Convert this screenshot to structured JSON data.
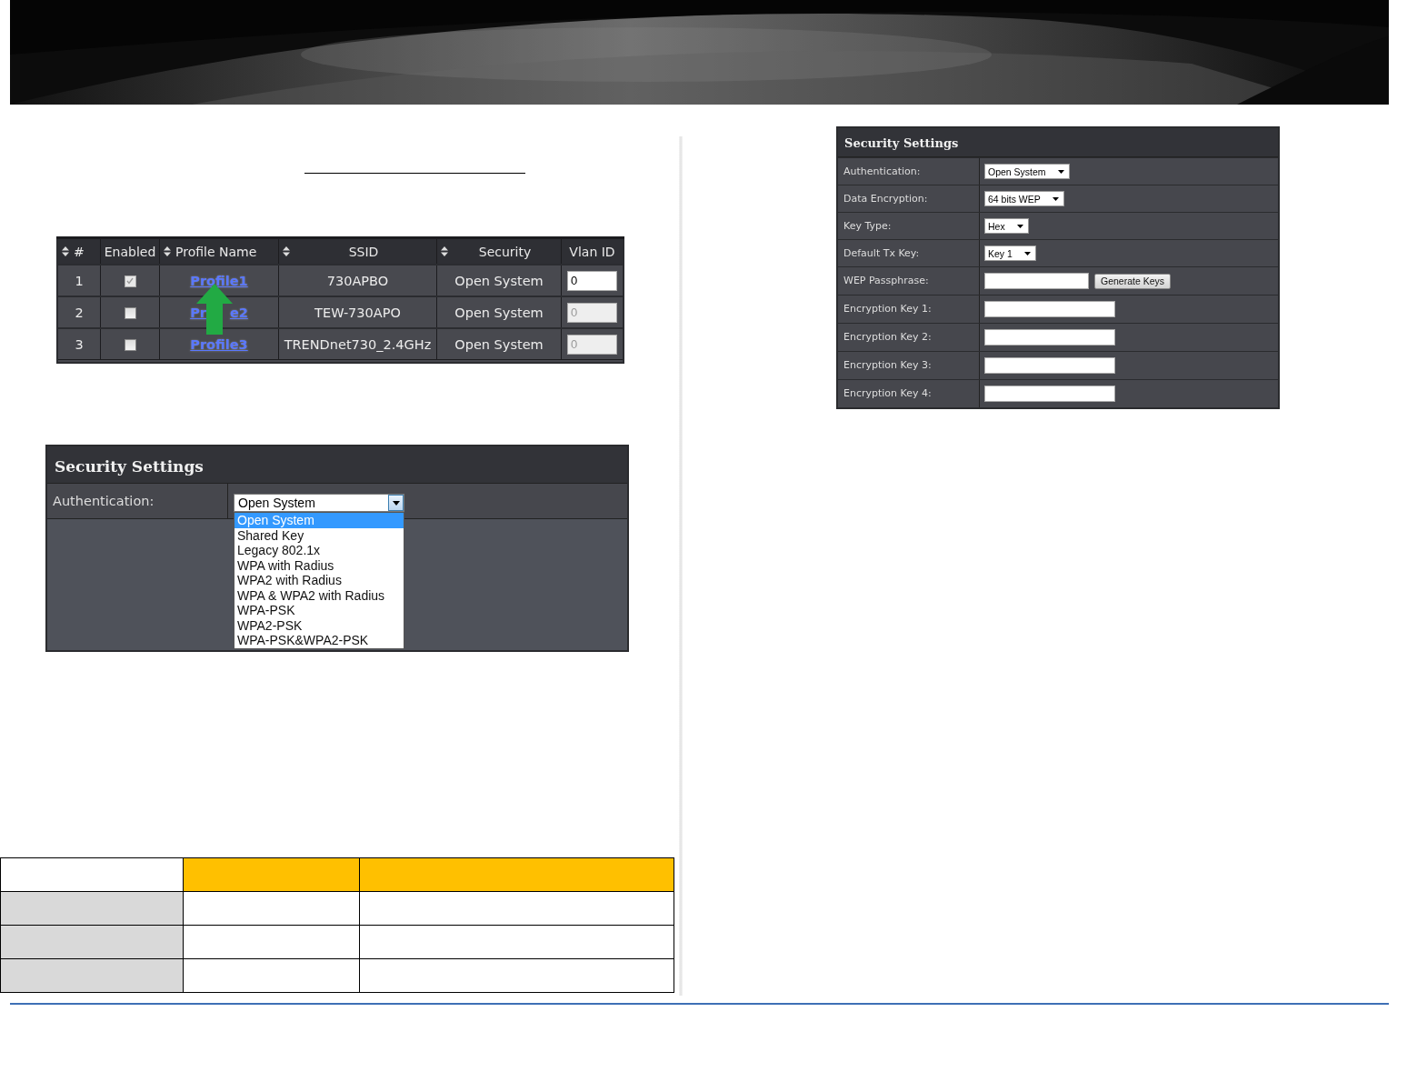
{
  "profiles_table": {
    "columns": [
      {
        "label": "#",
        "sortable": true
      },
      {
        "label": "Enabled",
        "sortable": false
      },
      {
        "label": "Profile Name",
        "sortable": true
      },
      {
        "label": "SSID",
        "sortable": true
      },
      {
        "label": "Security",
        "sortable": true
      },
      {
        "label": "Vlan ID",
        "sortable": false
      }
    ],
    "rows": [
      {
        "number": "1",
        "enabled": true,
        "enabled_disabled": true,
        "profile": "Profile1",
        "ssid": "730APBO",
        "security": "Open System",
        "vlan": "0",
        "vlan_disabled": false
      },
      {
        "number": "2",
        "enabled": false,
        "enabled_disabled": false,
        "profile": "Pr",
        "profile_end": "e2",
        "ssid": "TEW-730APO",
        "security": "Open System",
        "vlan": "0",
        "vlan_disabled": true
      },
      {
        "number": "3",
        "enabled": false,
        "enabled_disabled": false,
        "profile": "Profile3",
        "ssid": "TRENDnet730_2.4GHz",
        "security": "Open System",
        "vlan": "0",
        "vlan_disabled": true
      }
    ]
  },
  "security_dropdown_panel": {
    "title": "Security Settings",
    "label": "Authentication:",
    "value": "Open System",
    "expanded": true,
    "options": [
      {
        "label": "Open System",
        "selected": true
      },
      {
        "label": "Shared Key",
        "selected": false
      },
      {
        "label": "Legacy 802.1x",
        "selected": false
      },
      {
        "label": "WPA with Radius",
        "selected": false
      },
      {
        "label": "WPA2 with Radius",
        "selected": false
      },
      {
        "label": "WPA & WPA2 with Radius",
        "selected": false
      },
      {
        "label": "WPA-PSK",
        "selected": false
      },
      {
        "label": "WPA2-PSK",
        "selected": false
      },
      {
        "label": "WPA-PSK&WPA2-PSK",
        "selected": false
      }
    ]
  },
  "security_settings_panel": {
    "title": "Security Settings",
    "rows": [
      {
        "kind": "select",
        "label": "Authentication:",
        "value": "Open System"
      },
      {
        "kind": "select",
        "label": "Data Encryption:",
        "value": "64 bits WEP"
      },
      {
        "kind": "select",
        "label": "Key Type:",
        "value": "Hex"
      },
      {
        "kind": "select",
        "label": "Default Tx Key:",
        "value": "Key 1"
      },
      {
        "kind": "input_button",
        "label": "WEP Passphrase:",
        "button": "Generate Keys"
      },
      {
        "kind": "input",
        "label": "Encryption Key 1:"
      },
      {
        "kind": "input",
        "label": "Encryption Key 2:"
      },
      {
        "kind": "input",
        "label": "Encryption Key 3:"
      },
      {
        "kind": "input",
        "label": "Encryption Key 4:"
      }
    ]
  },
  "summary_table": {
    "rows": [
      {
        "kind": "header"
      },
      {
        "kind": "body"
      },
      {
        "kind": "body"
      },
      {
        "kind": "body"
      }
    ]
  }
}
